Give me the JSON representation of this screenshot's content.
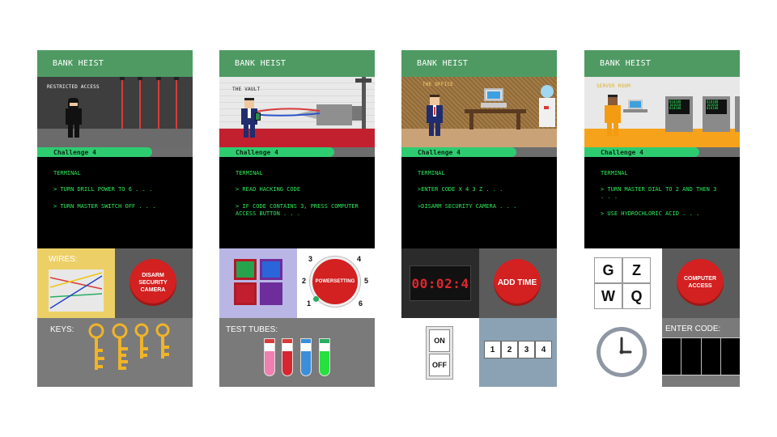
{
  "app": {
    "title": "BANK HEIST"
  },
  "colors": {
    "header": "#4f9a63",
    "progress": "#2ecc71",
    "terminal_text": "#2ee85a",
    "alarm_red": "#d32020"
  },
  "phones": [
    {
      "title": "BANK HEIST",
      "scene_label": "RESTRICTED ACCESS",
      "challenge": "Challenge 4",
      "progress_fraction": 0.74,
      "terminal": [
        "TERMINAL",
        "> TURN DRILL POWER TO 6 . . .",
        "> TURN MASTER SWITCH OFF . . ."
      ],
      "wires_label": "WIRES:",
      "button_label": "DISARM SECURITY CAMERA",
      "keys_label": "KEYS:"
    },
    {
      "title": "BANK HEIST",
      "scene_label": "THE VAULT",
      "challenge": "Challenge 4",
      "progress_fraction": 0.74,
      "terminal": [
        "TERMINAL",
        "> READ HACKING CODE",
        "> IF CODE CONTAINS 3, PRESS COMPUTER ACCESS BUTTON . . ."
      ],
      "dial_label": "POWERSETTING",
      "dial_numbers": [
        "1",
        "2",
        "3",
        "4",
        "5",
        "6"
      ],
      "tubes_label": "TEST TUBES:"
    },
    {
      "title": "BANK HEIST",
      "scene_label": "THE OFFICE",
      "challenge": "Challenge 4",
      "progress_fraction": 0.74,
      "terminal": [
        ">ENTER CODE X 4 3 Z . . .",
        ">DISARM SECURITY CAMERA . . ."
      ],
      "terminal_title": "TERMINAL",
      "timer": "00:02:4",
      "button_label": "ADD TIME",
      "switch_on": "ON",
      "switch_off": "OFF",
      "keypad": [
        "1",
        "2",
        "3",
        "4"
      ]
    },
    {
      "title": "BANK HEIST",
      "scene_label": "SERVER ROOM",
      "challenge": "Challenge 4",
      "progress_fraction": 0.74,
      "terminal": [
        "TERMINAL",
        "> TURN MASTER DIAL TO 2 AND THEN 3 . . .",
        "> USE HYDROCHLORIC ACID . . ."
      ],
      "letters": [
        "G",
        "Z",
        "W",
        "Q"
      ],
      "button_label": "COMPUTER ACCESS",
      "code_label": "ENTER CODE:"
    }
  ]
}
